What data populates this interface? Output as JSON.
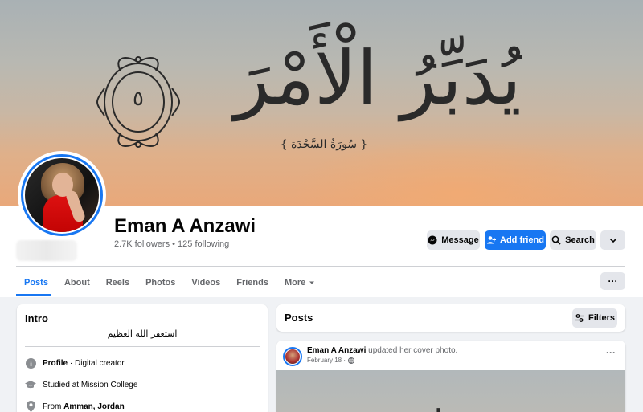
{
  "cover": {
    "arabic_text": "يُدَبِّرُ الْأَمْرَ",
    "caption": "{ سُورَةُ السَّجْدَة }",
    "medallion_digit": "٥"
  },
  "profile": {
    "name": "Eman A Anzawi",
    "followers_text": "2.7K followers • 125 following"
  },
  "actions": {
    "message_label": "Message",
    "add_friend_label": "Add friend",
    "search_label": "Search"
  },
  "tabs": [
    {
      "label": "Posts"
    },
    {
      "label": "About"
    },
    {
      "label": "Reels"
    },
    {
      "label": "Photos"
    },
    {
      "label": "Videos"
    },
    {
      "label": "Friends"
    },
    {
      "label": "More"
    }
  ],
  "intro": {
    "title": "Intro",
    "bio": "استغفر الله العظيم",
    "profile_label": "Profile",
    "profile_value": " · Digital creator",
    "studied": "Studied at Mission College",
    "from_prefix": "From ",
    "from_value": "Amman, Jordan"
  },
  "posts": {
    "title": "Posts",
    "filters_label": "Filters",
    "first_post": {
      "author": "Eman A Anzawi",
      "action": " updated her cover photo.",
      "date": "February 18 ·"
    }
  },
  "colors": {
    "accent": "#1877f2",
    "button_grey": "#e4e6eb",
    "text_secondary": "#65676b",
    "page_bg": "#f0f2f5"
  }
}
